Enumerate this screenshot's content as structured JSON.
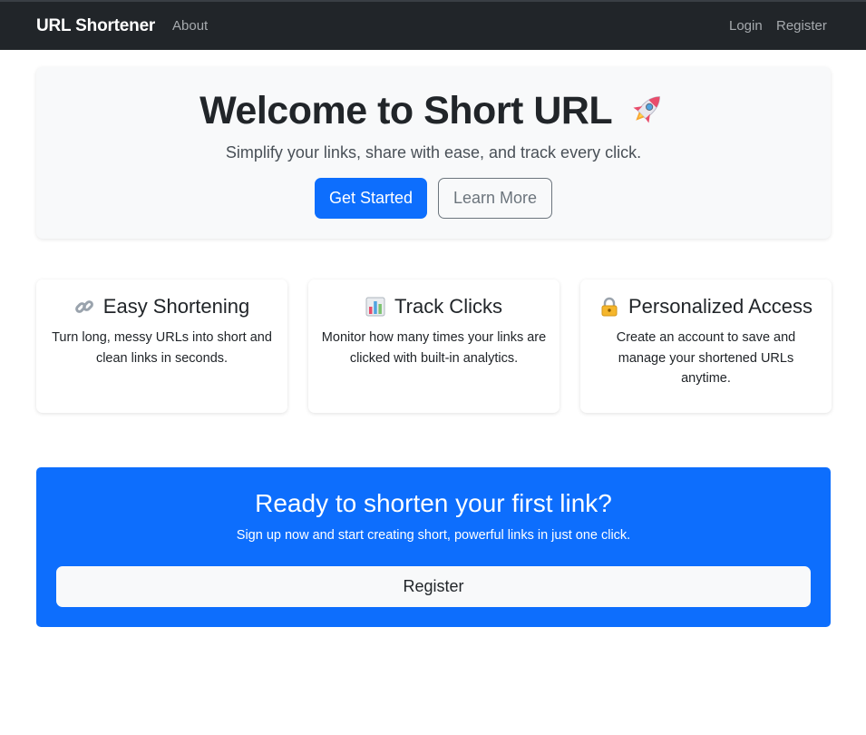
{
  "navbar": {
    "brand": "URL Shortener",
    "links": {
      "about": "About",
      "login": "Login",
      "register": "Register"
    }
  },
  "hero": {
    "title": "Welcome to Short URL",
    "title_icon": "rocket-icon",
    "subtitle": "Simplify your links, share with ease, and track every click.",
    "primary_button": "Get Started",
    "secondary_button": "Learn More"
  },
  "features": [
    {
      "icon": "link-icon",
      "title": "Easy Shortening",
      "text": "Turn long, messy URLs into short and clean links in seconds."
    },
    {
      "icon": "bar-chart-icon",
      "title": "Track Clicks",
      "text": "Monitor how many times your links are clicked with built-in analytics."
    },
    {
      "icon": "lock-icon",
      "title": "Personalized Access",
      "text": "Create an account to save and manage your shortened URLs anytime."
    }
  ],
  "cta": {
    "title": "Ready to shorten your first link?",
    "text": "Sign up now and start creating short, powerful links in just one click.",
    "button": "Register"
  },
  "colors": {
    "navbar_bg": "#212529",
    "primary": "#0d6efd",
    "hero_bg": "#f8f9fa",
    "secondary": "#6c757d"
  }
}
